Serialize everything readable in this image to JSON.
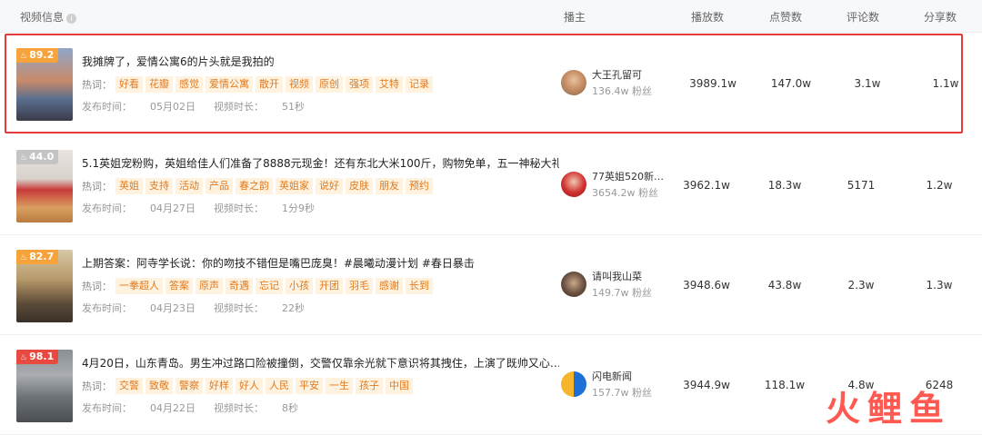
{
  "columns": {
    "video_info": "视频信息",
    "author": "播主",
    "plays": "播放数",
    "likes": "点赞数",
    "comments": "评论数",
    "shares": "分享数"
  },
  "labels": {
    "hot_words": "热词：",
    "publish_time": "发布时间：",
    "duration": "视频时长："
  },
  "rows": [
    {
      "score": "89.2",
      "badge_color": "#f5a33a",
      "title": "我摊牌了，爱情公寓6的片头就是我拍的",
      "tags": [
        "好看",
        "花瓣",
        "感觉",
        "爱情公寓",
        "散开",
        "视频",
        "原创",
        "强项",
        "艾特",
        "记录"
      ],
      "publish_date": "05月02日",
      "duration": "51秒",
      "author_name": "大王孔留可",
      "author_fans": "136.4w 粉丝",
      "plays": "3989.1w",
      "likes": "147.0w",
      "comments": "3.1w",
      "shares": "1.1w",
      "selected": true
    },
    {
      "score": "44.0",
      "badge_color": "#c4c4c4",
      "title": "5.1英姐宠粉购，英姐给佳人们准备了8888元现金！还有东北大米100斤，购物免单，五一神秘大礼…",
      "tags": [
        "英姐",
        "支持",
        "活动",
        "产品",
        "春之韵",
        "英姐家",
        "说好",
        "皮肤",
        "朋友",
        "预约"
      ],
      "publish_date": "04月27日",
      "duration": "1分9秒",
      "author_name": "77英姐520新品…",
      "author_fans": "3654.2w 粉丝",
      "plays": "3962.1w",
      "likes": "18.3w",
      "comments": "5171",
      "shares": "1.2w",
      "selected": false
    },
    {
      "score": "82.7",
      "badge_color": "#f5a33a",
      "title": "上期答案：阿寺学长说：你的吻技不错但是嘴巴庞臭！#晨曦动漫计划 #春日暴击",
      "tags": [
        "一拳超人",
        "答案",
        "原声",
        "奇遇",
        "忘记",
        "小孩",
        "开团",
        "羽毛",
        "感谢",
        "长到"
      ],
      "publish_date": "04月23日",
      "duration": "22秒",
      "author_name": "请叫我山菜",
      "author_fans": "149.7w 粉丝",
      "plays": "3948.6w",
      "likes": "43.8w",
      "comments": "2.3w",
      "shares": "1.3w",
      "selected": false
    },
    {
      "score": "98.1",
      "badge_color": "#e84a3f",
      "title": "4月20日，山东青岛。男生冲过路口险被撞倒，交警仅靠余光就下意识将其拽住，上演了既帅又心…",
      "tags": [
        "交警",
        "致敬",
        "警察",
        "好样",
        "好人",
        "人民",
        "平安",
        "一生",
        "孩子",
        "中国"
      ],
      "publish_date": "04月22日",
      "duration": "8秒",
      "author_name": "闪电新闻",
      "author_fans": "157.7w 粉丝",
      "plays": "3944.9w",
      "likes": "118.1w",
      "comments": "4.8w",
      "shares": "6248",
      "selected": false
    }
  ],
  "watermark": "火鲤鱼"
}
